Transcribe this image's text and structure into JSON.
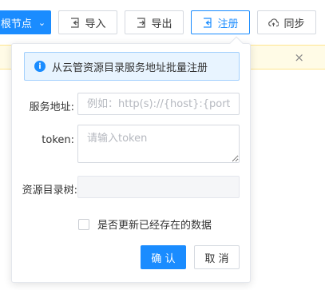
{
  "toolbar": {
    "node_button_label": "根节点",
    "import_label": "导入",
    "export_label": "导出",
    "register_label": "注册",
    "sync_label": "同步"
  },
  "banner": {
    "close_symbol": "×"
  },
  "popover": {
    "info_text": "从云管资源目录服务地址批量注册",
    "service_address_label": "服务地址:",
    "service_address_placeholder": "例如：http(s)://{host}:{port}",
    "token_label": "token:",
    "token_placeholder": "请输入token",
    "resource_tree_label": "资源目录树:",
    "checkbox_label": "是否更新已经存在的数据",
    "confirm_label": "确 认",
    "cancel_label": "取 消"
  },
  "colors": {
    "primary": "#1a8cff",
    "banner_bg": "#fffbe6",
    "info_bg": "#e8f4ff"
  },
  "icons": {
    "import": "import-icon",
    "export": "export-icon",
    "register": "register-icon",
    "sync": "cloud-sync-icon",
    "info": "info-icon",
    "chevron": "chevron-down-icon"
  }
}
